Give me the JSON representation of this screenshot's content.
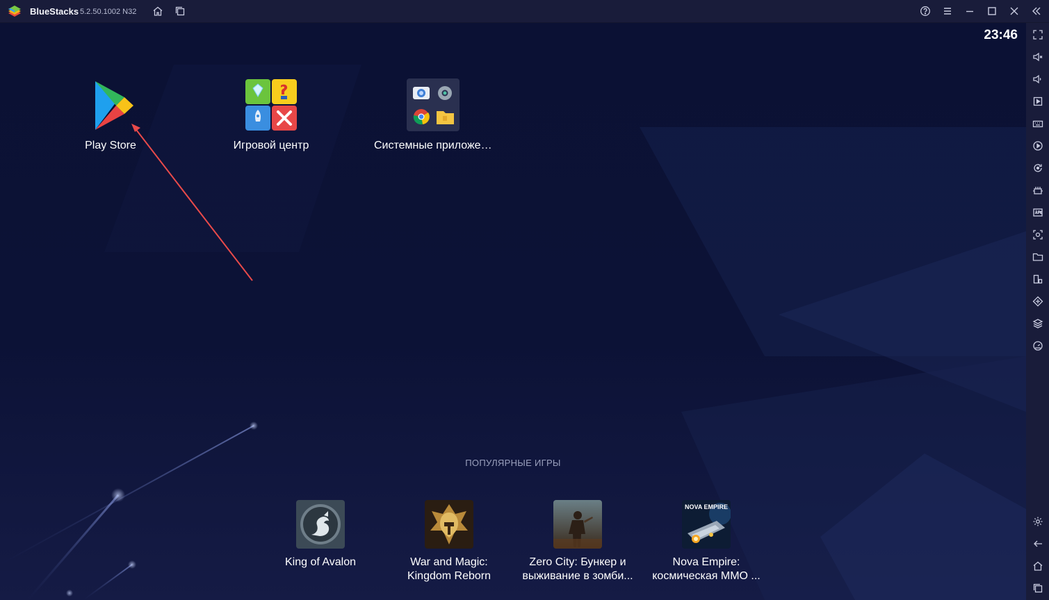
{
  "titlebar": {
    "app_name": "BlueStacks",
    "version": "5.2.50.1002 N32",
    "icons": [
      "home-icon",
      "multi-instance-icon",
      "help-icon",
      "menu-icon",
      "minimize-icon",
      "maximize-icon",
      "close-icon",
      "collapse-sidebar-icon"
    ]
  },
  "screen": {
    "clock": "23:46",
    "apps": [
      {
        "label": "Play Store",
        "icon": "play-store-icon"
      },
      {
        "label": "Игровой центр",
        "icon": "game-center-icon"
      },
      {
        "label": "Системные приложения",
        "icon": "system-apps-folder-icon"
      }
    ],
    "popular_title": "ПОПУЛЯРНЫЕ ИГРЫ",
    "games": [
      {
        "line1": "King of Avalon",
        "line2": ""
      },
      {
        "line1": "War and Magic:",
        "line2": "Kingdom Reborn"
      },
      {
        "line1": "Zero City: Бункер и",
        "line2": "выживание в зомби..."
      },
      {
        "line1": "Nova Empire:",
        "line2": "космическая MMO ..."
      }
    ],
    "nova_logo_text": "NOVA EMPIRE"
  },
  "sidebar": {
    "icons": [
      "fullscreen-icon",
      "volume-up-icon",
      "volume-down-icon",
      "screen-record-icon",
      "keyboard-icon",
      "macro-icon",
      "sync-icon",
      "performance-icon",
      "apk-install-icon",
      "screenshot-icon",
      "folder-icon",
      "multi-instance-manager-icon",
      "eco-mode-icon",
      "layers-icon",
      "realtime-translate-icon",
      "settings-icon",
      "back-icon",
      "android-home-icon",
      "recent-apps-icon"
    ]
  },
  "colors": {
    "titlebar_bg": "#191c3a",
    "screen_bg": "#0b1134",
    "annotation_arrow": "#e84a4a"
  }
}
